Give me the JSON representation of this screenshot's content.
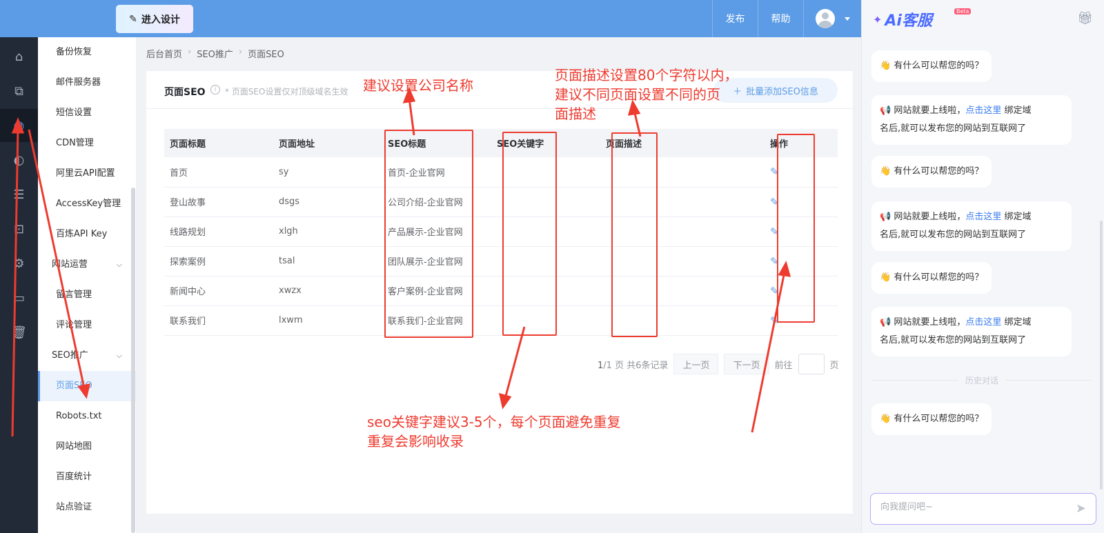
{
  "topbar": {
    "design_button": "进入设计",
    "publish": "发布",
    "help": "帮助"
  },
  "rail_icons": [
    "home-icon",
    "copy-icon",
    "seo-icon",
    "palette-icon",
    "list-icon",
    "shop-bag-icon",
    "gear-icon",
    "terminal-icon",
    "trash-icon"
  ],
  "subnav": {
    "items_top": [
      "备份恢复",
      "邮件服务器",
      "短信设置",
      "CDN管理",
      "阿里云API配置",
      "AccessKey管理",
      "百炼API Key"
    ],
    "group_ops": "网站运营",
    "items_ops": [
      "留言管理",
      "评论管理"
    ],
    "group_seo": "SEO推广",
    "items_seo": [
      "页面SEO",
      "Robots.txt",
      "网站地图",
      "百度统计",
      "站点验证"
    ]
  },
  "breadcrumb": [
    "后台首页",
    "SEO推广",
    "页面SEO"
  ],
  "card": {
    "title": "页面SEO",
    "hint": "* 页面SEO设置仅对顶级域名生效",
    "batch_button": "批量添加SEO信息"
  },
  "table": {
    "headers": [
      "页面标题",
      "页面地址",
      "SEO标题",
      "SEO关键字",
      "页面描述",
      "操作"
    ],
    "rows": [
      [
        "首页",
        "sy",
        "首页-企业官网",
        "",
        ""
      ],
      [
        "登山故事",
        "dsgs",
        "公司介绍-企业官网",
        "",
        ""
      ],
      [
        "线路规划",
        "xlgh",
        "产品展示-企业官网",
        "",
        ""
      ],
      [
        "探索案例",
        "tsal",
        "团队展示-企业官网",
        "",
        ""
      ],
      [
        "新闻中心",
        "xwzx",
        "客户案例-企业官网",
        "",
        ""
      ],
      [
        "联系我们",
        "lxwm",
        "联系我们-企业官网",
        "",
        ""
      ]
    ]
  },
  "pagination": {
    "current": "1",
    "total_text": "/1 页 共6条记录",
    "prev": "上一页",
    "next": "下一页",
    "goto": "前往",
    "page_unit": "页"
  },
  "annotations": {
    "company_name": "建议设置公司名称",
    "description": [
      "页面描述设置80个字符以内，",
      "建议不同页面设置不同的页",
      "面描述"
    ],
    "keywords": [
      "seo关键字建议3-5个，每个页面避免重复",
      "重复会影响收录"
    ],
    "color": "#ee3b2f"
  },
  "ai_panel": {
    "logo_text": "Ai客服",
    "beta": "Beta",
    "greeting": "有什么可以帮您的吗？",
    "launch_pre": "网站就要上线啦，",
    "launch_link": "点击这里",
    "launch_post": "绑定域",
    "launch_line2": "名后,就可以发布您的网站到互联网了",
    "history": "历史对话",
    "input_placeholder": "向我提问吧~"
  },
  "colors": {
    "accent": "#5c9ce6",
    "rail_bg": "#222a37"
  }
}
